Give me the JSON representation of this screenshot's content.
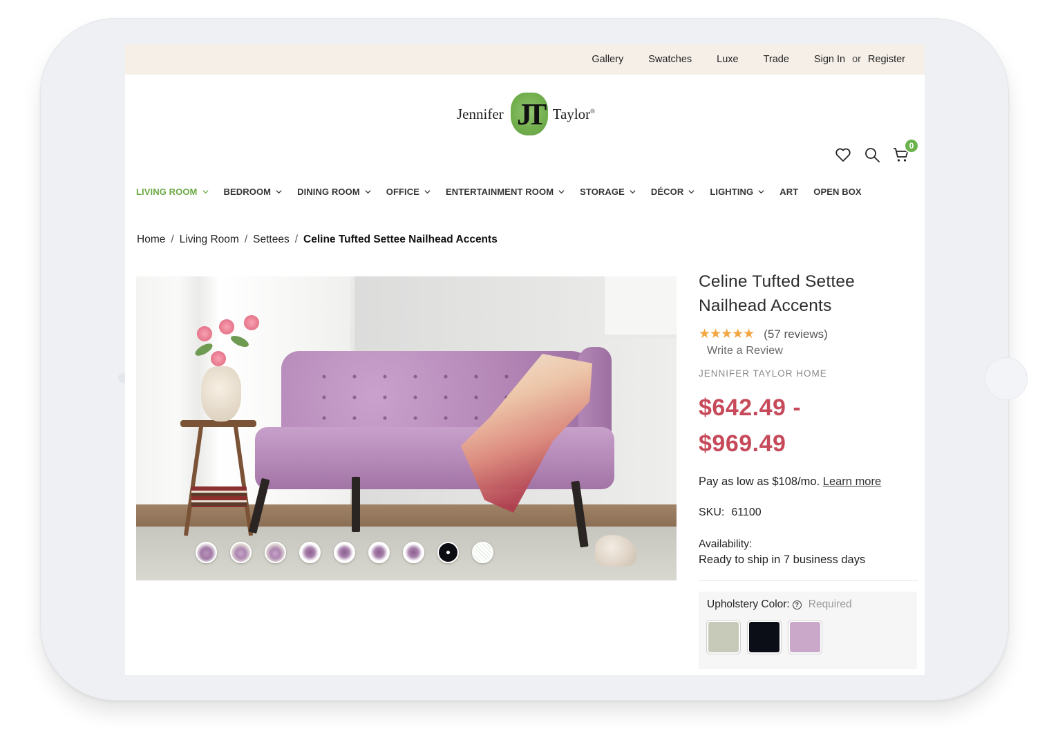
{
  "topbar": {
    "links": [
      "Gallery",
      "Swatches",
      "Luxe",
      "Trade"
    ],
    "sign_in": "Sign In",
    "or": "or",
    "register": "Register"
  },
  "logo": {
    "left_word": "Jennifer",
    "monogram": "JT",
    "right_word": "Taylor",
    "reg": "®"
  },
  "header": {
    "cart_count": "0",
    "icons": [
      "heart-icon",
      "search-icon",
      "cart-icon"
    ]
  },
  "nav": {
    "items": [
      {
        "label": "LIVING ROOM",
        "has_dropdown": true,
        "active": true
      },
      {
        "label": "BEDROOM",
        "has_dropdown": true
      },
      {
        "label": "DINING ROOM",
        "has_dropdown": true
      },
      {
        "label": "OFFICE",
        "has_dropdown": true
      },
      {
        "label": "ENTERTAINMENT ROOM",
        "has_dropdown": true
      },
      {
        "label": "STORAGE",
        "has_dropdown": true
      },
      {
        "label": "DÉCOR",
        "has_dropdown": true
      },
      {
        "label": "LIGHTING",
        "has_dropdown": true
      },
      {
        "label": "ART",
        "has_dropdown": false
      },
      {
        "label": "OPEN BOX",
        "has_dropdown": false
      }
    ],
    "active_color": "#6aaa43"
  },
  "breadcrumb": {
    "items": [
      "Home",
      "Living Room",
      "Settees"
    ],
    "separator": "/",
    "current": "Celine Tufted Settee Nailhead Accents"
  },
  "gallery": {
    "thumbnail_count": 9
  },
  "product": {
    "title": "Celine Tufted Settee Nailhead Accents",
    "stars": "★★★★★",
    "rating": 5,
    "reviews": "(57 reviews)",
    "write_review": "Write a Review",
    "brand": "JENNIFER TAYLOR HOME",
    "price_low": "$642.49 -",
    "price_high": "$969.49",
    "price_color": "#c64a5a",
    "pay_text": "Pay as low as $108/mo.",
    "learn_more": "Learn more",
    "sku_label": "SKU:",
    "sku": "61100",
    "availability_label": "Availability:",
    "availability": "Ready to ship in 7 business days"
  },
  "options": {
    "label": "Upholstery Color:",
    "required": "Required",
    "swatches": [
      {
        "name": "sage",
        "color": "#c7cab8"
      },
      {
        "name": "black",
        "color": "#0b0e16"
      },
      {
        "name": "lavender",
        "color": "#c9a8c9"
      }
    ]
  }
}
